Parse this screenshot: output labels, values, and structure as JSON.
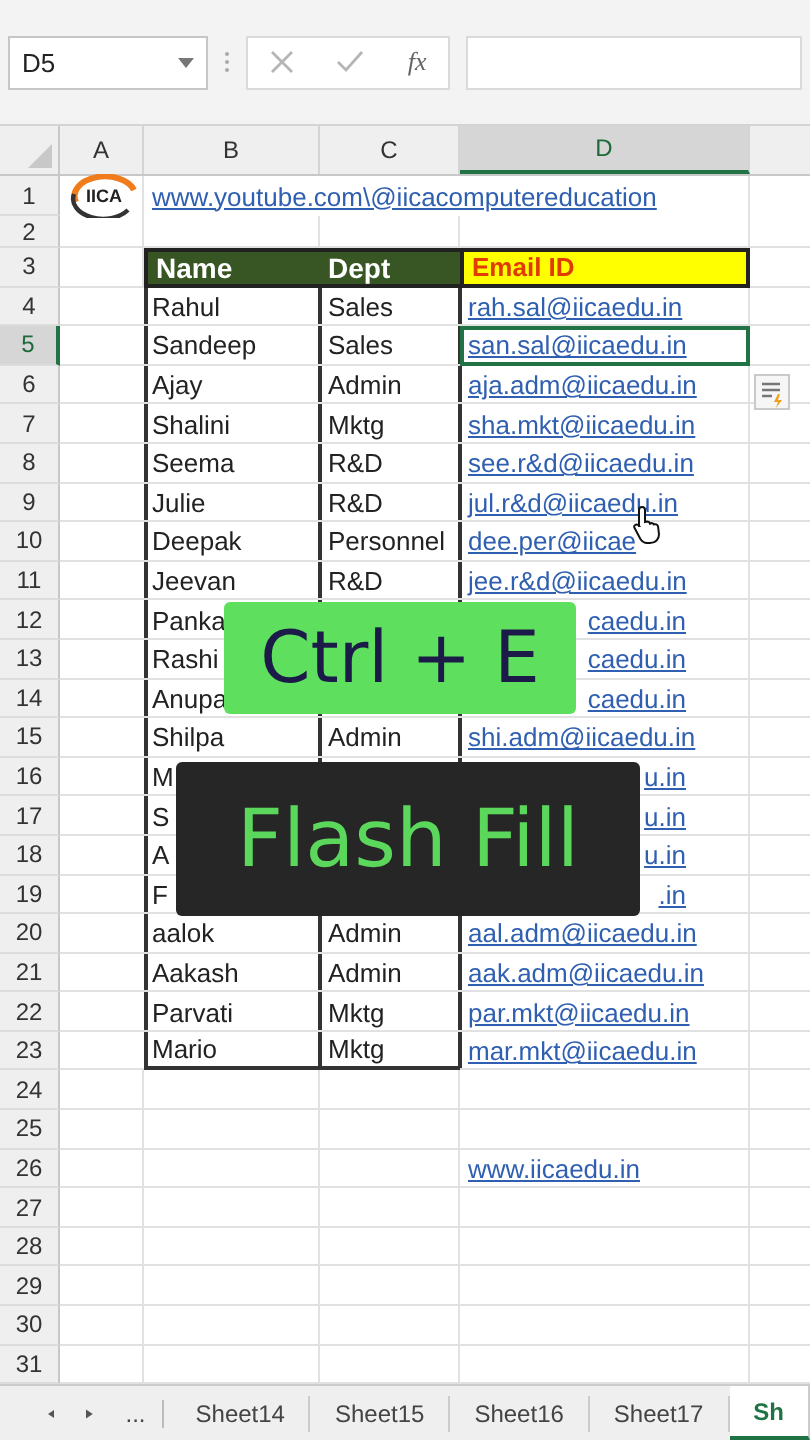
{
  "formula_bar": {
    "name_box": "D5",
    "function_label": "fx"
  },
  "columns": [
    {
      "label": "A",
      "selected": false
    },
    {
      "label": "B",
      "selected": false
    },
    {
      "label": "C",
      "selected": false
    },
    {
      "label": "D",
      "selected": true
    }
  ],
  "rows": [
    {
      "number": "1",
      "kind": "logo_link",
      "selected": false,
      "logo": "IICA",
      "link": "www.youtube.com\\@iicacomputereducation"
    },
    {
      "number": "2",
      "kind": "blank",
      "selected": false
    },
    {
      "number": "3",
      "kind": "header",
      "selected": false,
      "name": "Name",
      "dept": "Dept",
      "email": "Email ID"
    },
    {
      "number": "4",
      "kind": "data",
      "selected": false,
      "name": "Rahul",
      "dept": "Sales",
      "email": "rah.sal@iicaedu.in"
    },
    {
      "number": "5",
      "kind": "data",
      "selected": true,
      "name": "Sandeep",
      "dept": "Sales",
      "email": "san.sal@iicaedu.in"
    },
    {
      "number": "6",
      "kind": "data",
      "selected": false,
      "name": "Ajay",
      "dept": "Admin",
      "email": "aja.adm@iicaedu.in"
    },
    {
      "number": "7",
      "kind": "data",
      "selected": false,
      "name": "Shalini",
      "dept": "Mktg",
      "email": "sha.mkt@iicaedu.in"
    },
    {
      "number": "8",
      "kind": "data",
      "selected": false,
      "name": "Seema",
      "dept": "R&D",
      "email": "see.r&d@iicaedu.in"
    },
    {
      "number": "9",
      "kind": "data",
      "selected": false,
      "name": "Julie",
      "dept": "R&D",
      "email": "jul.r&d@iicaedu.in"
    },
    {
      "number": "10",
      "kind": "data",
      "selected": false,
      "name": "Deepak",
      "dept": "Personnel",
      "email": "dee.per@iicae"
    },
    {
      "number": "11",
      "kind": "data",
      "selected": false,
      "name": "Jeevan",
      "dept": "R&D",
      "email": "jee.r&d@iicaedu.in"
    },
    {
      "number": "12",
      "kind": "data",
      "selected": false,
      "partly_covered": true,
      "name": "Panka",
      "email": "caedu.in"
    },
    {
      "number": "13",
      "kind": "data",
      "selected": false,
      "partly_covered": true,
      "name": "Rashi",
      "email": "caedu.in"
    },
    {
      "number": "14",
      "kind": "data",
      "selected": false,
      "partly_covered": true,
      "name": "Anupa",
      "email": "caedu.in"
    },
    {
      "number": "15",
      "kind": "data",
      "selected": false,
      "name": "Shilpa",
      "dept": "Admin",
      "email": "shi.adm@iicaedu.in"
    },
    {
      "number": "16",
      "kind": "data",
      "selected": false,
      "partly_covered": true,
      "name": "M",
      "email": "u.in"
    },
    {
      "number": "17",
      "kind": "data",
      "selected": false,
      "partly_covered": true,
      "name": "S",
      "email": "u.in"
    },
    {
      "number": "18",
      "kind": "data",
      "selected": false,
      "partly_covered": true,
      "name": "A",
      "email": "u.in"
    },
    {
      "number": "19",
      "kind": "data",
      "selected": false,
      "partly_covered": true,
      "name": "F",
      "email": ".in"
    },
    {
      "number": "20",
      "kind": "data",
      "selected": false,
      "name": "aalok",
      "dept": "Admin",
      "email": "aal.adm@iicaedu.in"
    },
    {
      "number": "21",
      "kind": "data",
      "selected": false,
      "name": "Aakash",
      "dept": "Admin",
      "email": "aak.adm@iicaedu.in"
    },
    {
      "number": "22",
      "kind": "data",
      "selected": false,
      "name": "Parvati",
      "dept": "Mktg",
      "email": "par.mkt@iicaedu.in"
    },
    {
      "number": "23",
      "kind": "data",
      "selected": false,
      "name": "Mario",
      "dept": "Mktg",
      "email": "mar.mkt@iicaedu.in",
      "last": true
    },
    {
      "number": "24",
      "kind": "blank",
      "selected": false
    },
    {
      "number": "25",
      "kind": "blank",
      "selected": false
    },
    {
      "number": "26",
      "kind": "link",
      "selected": false,
      "link": "www.iicaedu.in"
    },
    {
      "number": "27",
      "kind": "blank",
      "selected": false
    },
    {
      "number": "28",
      "kind": "blank",
      "selected": false
    },
    {
      "number": "29",
      "kind": "blank",
      "selected": false
    },
    {
      "number": "30",
      "kind": "blank",
      "selected": false
    },
    {
      "number": "31",
      "kind": "blank",
      "selected": false
    }
  ],
  "sheet_tabs": {
    "more": "...",
    "tabs": [
      {
        "label": "Sheet14",
        "selected": false
      },
      {
        "label": "Sheet15",
        "selected": false
      },
      {
        "label": "Sheet16",
        "selected": false
      },
      {
        "label": "Sheet17",
        "selected": false
      },
      {
        "label": "Sh",
        "selected": true
      }
    ]
  },
  "overlays": [
    {
      "kind": "key",
      "text": "Ctrl + E"
    },
    {
      "kind": "title",
      "text": "Flash Fill"
    }
  ]
}
